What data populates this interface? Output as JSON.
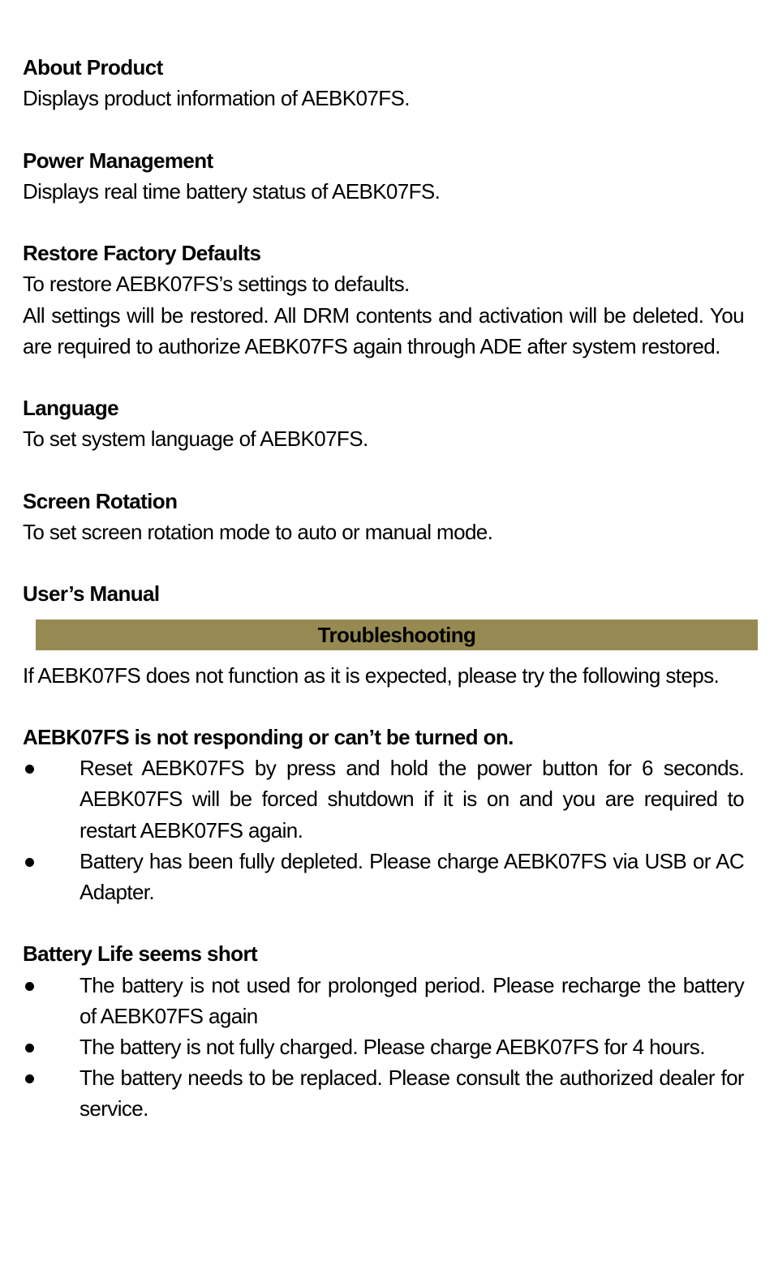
{
  "settings_items": [
    {
      "title": "About Product",
      "lines": [
        "Displays product information of AEBK07FS."
      ]
    },
    {
      "title": "Power Management",
      "lines": [
        "Displays real time battery status of AEBK07FS."
      ]
    },
    {
      "title": "Restore Factory Defaults",
      "lines": [
        "To restore AEBK07FS’s settings to defaults.",
        "All settings will be restored. All DRM contents and activation will be deleted. You are required to authorize AEBK07FS again through ADE after system restored."
      ]
    },
    {
      "title": "Language",
      "lines": [
        "To set system language of AEBK07FS."
      ]
    },
    {
      "title": "Screen Rotation",
      "lines": [
        "To set screen rotation mode to auto or manual mode."
      ]
    },
    {
      "title": "User’s Manual",
      "lines": []
    }
  ],
  "troubleshooting": {
    "banner": "Troubleshooting",
    "banner_color": "#968a52",
    "intro": "If AEBK07FS does not function as it is expected, please try the following steps.",
    "issues": [
      {
        "title": "AEBK07FS is not responding or can’t be turned on.",
        "bullets": [
          "Reset AEBK07FS by press and hold the power button for 6 seconds. AEBK07FS will be forced shutdown if it is on and you are required to restart AEBK07FS again.",
          "Battery has been fully depleted. Please charge AEBK07FS via USB or AC Adapter."
        ]
      },
      {
        "title": "Battery Life seems short",
        "bullets": [
          "The battery is not used for prolonged period. Please recharge the battery of AEBK07FS again",
          "The battery is not fully charged. Please charge AEBK07FS for 4 hours.",
          "The battery needs to be replaced. Please consult the authorized dealer for service."
        ]
      }
    ]
  }
}
